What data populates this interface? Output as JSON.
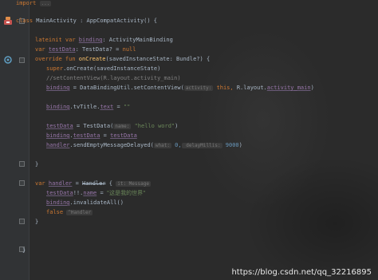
{
  "editor": {
    "import_kw": "import",
    "import_hint": "...",
    "line1": {
      "kw": "class",
      "name": " MainActivity : AppCompatActivity() {"
    },
    "line2": {
      "kw": "lateinit var",
      "prop": "binding",
      "rest": ": ActivityMainBinding"
    },
    "line3": {
      "kw": "var",
      "prop": "testData",
      "rest": ": TestData? = ",
      "null": "null"
    },
    "line4": {
      "kw": "override fun",
      "fn": "onCreate",
      "rest": "(savedInstanceState: Bundle?) {"
    },
    "line5": {
      "kw": "super",
      "rest": ".onCreate(savedInstanceState)"
    },
    "line6": {
      "comment": "//setContentView(R.layout.activity_main)"
    },
    "line7": {
      "prop": "binding",
      "rest1": " = DataBindingUtil.setContentView(",
      "hint": "activity:",
      "kw": " this,",
      "rest2": " R.layout.",
      "prop2": "activity_main",
      "rest3": ")"
    },
    "line8": {
      "prop": "binding",
      "rest1": ".tvTitle.",
      "prop2": "text",
      "rest2": " = ",
      "str": "\"\""
    },
    "line9": {
      "prop": "testData",
      "rest1": " = TestData(",
      "hint": "name:",
      "str": " \"hello word\"",
      "rest2": ")"
    },
    "line10": {
      "prop": "binding",
      "rest1": ".",
      "prop2": "testData",
      "rest2": " = ",
      "prop3": "testData"
    },
    "line11": {
      "prop": "handler",
      "rest1": ".sendEmptyMessageDelayed(",
      "hint1": "what:",
      "num1": " 0,",
      "hint2": " delayMillis:",
      "num2": " 9000",
      "rest2": ")"
    },
    "line12": {
      "text": "}"
    },
    "line13": {
      "kw": "var",
      "prop": "handler",
      "rest1": " = ",
      "cls": "Handler",
      "rest2": " {",
      "hint": "it: Message"
    },
    "line14": {
      "prop": "testData",
      "rest1": "!!.",
      "prop2": "name",
      "rest2": " = ",
      "str": "\"这是我的世界\""
    },
    "line15": {
      "prop": "binding",
      "rest1": ".invalidateAll()"
    },
    "line16": {
      "kw": "false",
      "hint": "^Handler"
    },
    "line17": {
      "text": "}"
    },
    "line18": {
      "text": "}"
    }
  },
  "watermark": "https://blog.csdn.net/qq_32216895",
  "colors": {
    "background": "#2b2b2b",
    "keyword": "#cc7832",
    "property": "#9876aa",
    "function": "#ffc66d",
    "string": "#6a8759",
    "number": "#6897bb",
    "comment": "#808080"
  },
  "gutter_icons": [
    "class-run-icon",
    "override-icon"
  ]
}
